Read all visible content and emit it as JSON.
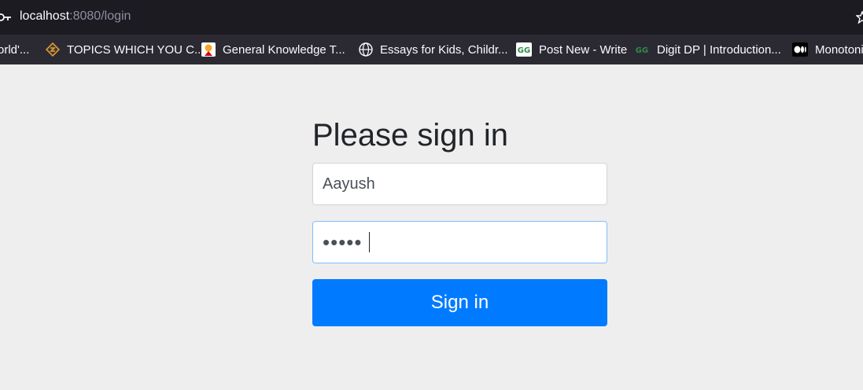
{
  "browser": {
    "url_host": "localhost",
    "url_path": ":8080/login"
  },
  "bookmarks": [
    {
      "label": "orld'...",
      "icon": "globe-icon"
    },
    {
      "label": "TOPICS WHICH YOU C...",
      "icon": "topics-icon"
    },
    {
      "label": "General Knowledge T...",
      "icon": "general-knowledge-icon"
    },
    {
      "label": "Essays for Kids, Childr...",
      "icon": "globe-icon"
    },
    {
      "label": "Post New - Write",
      "icon": "geeksforgeeks-icon"
    },
    {
      "label": "Digit DP | Introduction...",
      "icon": "geeksforgeeks-icon"
    },
    {
      "label": "Monotoni",
      "icon": "medium-icon"
    }
  ],
  "login": {
    "heading": "Please sign in",
    "username_value": "Aayush",
    "password_value": "•••••",
    "submit_label": "Sign in"
  },
  "colors": {
    "primary": "#007bff",
    "page_bg": "#eeeeee",
    "urlbar_bg": "#1c1b22",
    "bookmarks_bg": "#2b2a33",
    "gfg_green": "#2f8d46"
  }
}
